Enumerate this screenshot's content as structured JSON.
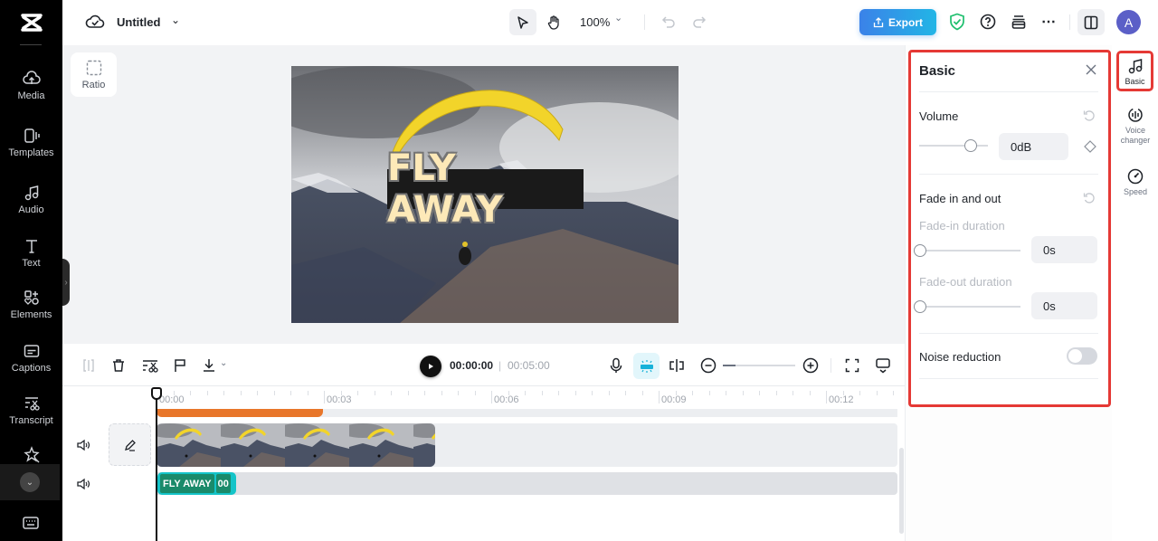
{
  "app": {
    "project_title": "Untitled"
  },
  "left_nav": {
    "items": [
      {
        "label": "Media",
        "icon": "cloud-upload-icon"
      },
      {
        "label": "Templates",
        "icon": "templates-icon"
      },
      {
        "label": "Audio",
        "icon": "music-note-icon"
      },
      {
        "label": "Text",
        "icon": "text-icon"
      },
      {
        "label": "Elements",
        "icon": "elements-icon"
      },
      {
        "label": "Captions",
        "icon": "captions-icon"
      },
      {
        "label": "Transcript",
        "icon": "transcript-icon"
      },
      {
        "label": "Effects",
        "icon": "effects-icon"
      }
    ]
  },
  "topbar": {
    "zoom_level": "100%",
    "export_label": "Export",
    "avatar_initial": "A"
  },
  "canvas": {
    "ratio_label": "Ratio",
    "overlay_text": "FLY AWAY"
  },
  "timeline": {
    "current_time": "00:00:00",
    "separator": "|",
    "total_time": "00:05:00",
    "zoom_level": 0.1,
    "ruler_labels": [
      "00:00",
      "00:03",
      "00:06",
      "00:09",
      "00:12"
    ],
    "text_clip_label": "FLY AWAY",
    "text_clip_label2": "00"
  },
  "panel": {
    "title": "Basic",
    "volume_label": "Volume",
    "volume_value": "0dB",
    "volume_slider_fraction": 0.8,
    "fade_label": "Fade in and out",
    "fade_in_label": "Fade-in duration",
    "fade_in_value": "0s",
    "fade_in_fraction": 0,
    "fade_out_label": "Fade-out duration",
    "fade_out_value": "0s",
    "fade_out_fraction": 0,
    "noise_label": "Noise reduction",
    "noise_enabled": false
  },
  "side_tabs": [
    {
      "label": "Basic",
      "active": true
    },
    {
      "label": "Voice changer",
      "active": false
    },
    {
      "label": "Speed",
      "active": false
    }
  ],
  "colors": {
    "accent": "#22b5e6",
    "highlight_border": "#e53935",
    "audio_track": "#e8762a",
    "text_clip": "#14c4c8"
  }
}
